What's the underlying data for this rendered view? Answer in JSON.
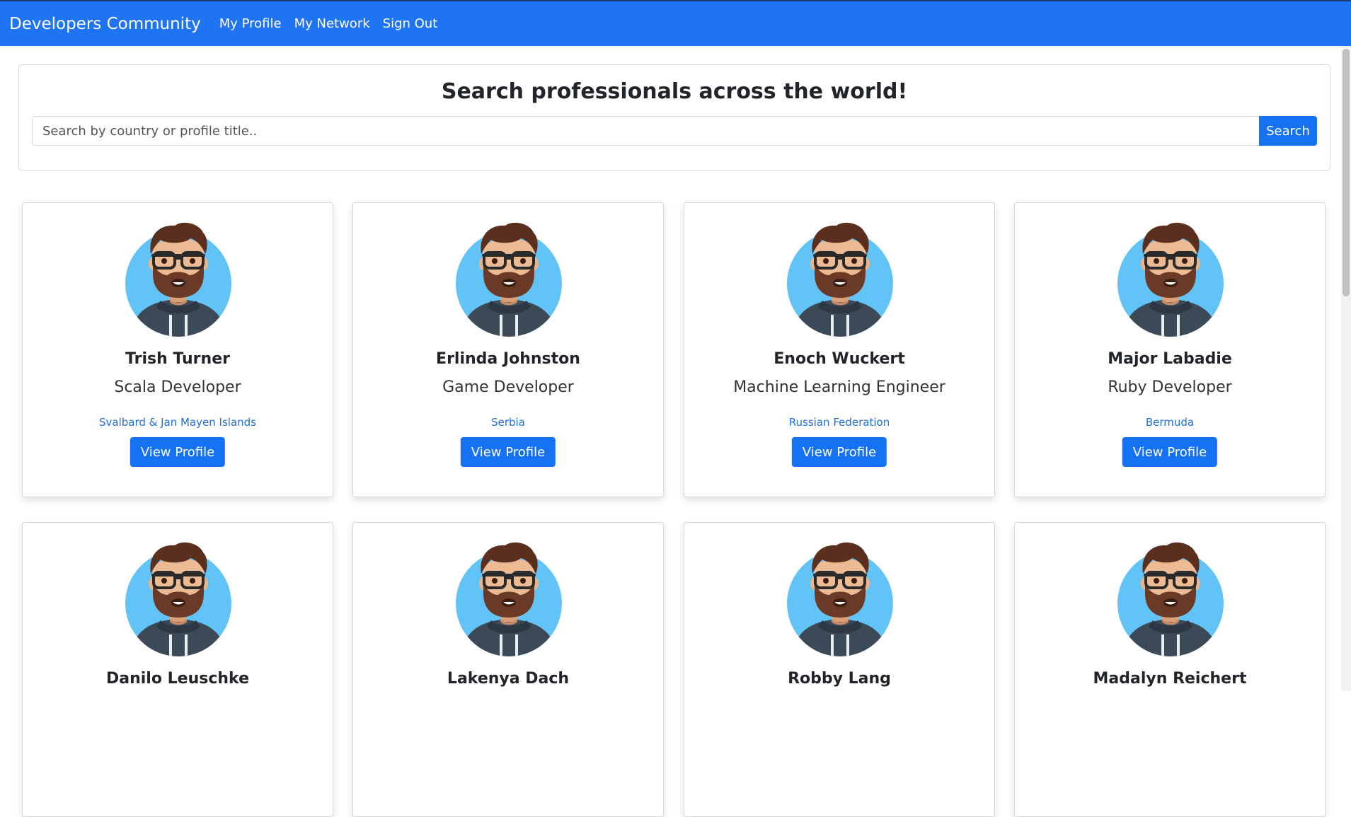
{
  "nav": {
    "brand": "Developers Community",
    "links": [
      "My Profile",
      "My Network",
      "Sign Out"
    ]
  },
  "search": {
    "title": "Search professionals across the world!",
    "placeholder": "Search by country or profile title..",
    "button_label": "Search"
  },
  "colors": {
    "primary": "#1572f5",
    "navbar": "#1f74f3",
    "link": "#1d6fe0",
    "avatar_bg": "#62c3f6"
  },
  "profiles": [
    {
      "name": "Trish Turner",
      "title": "Scala Developer",
      "country": "Svalbard & Jan Mayen Islands",
      "button": "View Profile",
      "icon": "developer-avatar-icon"
    },
    {
      "name": "Erlinda Johnston",
      "title": "Game Developer",
      "country": "Serbia",
      "button": "View Profile",
      "icon": "developer-avatar-icon"
    },
    {
      "name": "Enoch Wuckert",
      "title": "Machine Learning Engineer",
      "country": "Russian Federation",
      "button": "View Profile",
      "icon": "developer-avatar-icon"
    },
    {
      "name": "Major Labadie",
      "title": "Ruby Developer",
      "country": "Bermuda",
      "button": "View Profile",
      "icon": "developer-avatar-icon"
    },
    {
      "name": "Danilo Leuschke",
      "title": "",
      "country": "",
      "button": "",
      "icon": "developer-avatar-icon"
    },
    {
      "name": "Lakenya Dach",
      "title": "",
      "country": "",
      "button": "",
      "icon": "developer-avatar-icon"
    },
    {
      "name": "Robby Lang",
      "title": "",
      "country": "",
      "button": "",
      "icon": "developer-avatar-icon"
    },
    {
      "name": "Madalyn Reichert",
      "title": "",
      "country": "",
      "button": "",
      "icon": "developer-avatar-icon"
    }
  ]
}
